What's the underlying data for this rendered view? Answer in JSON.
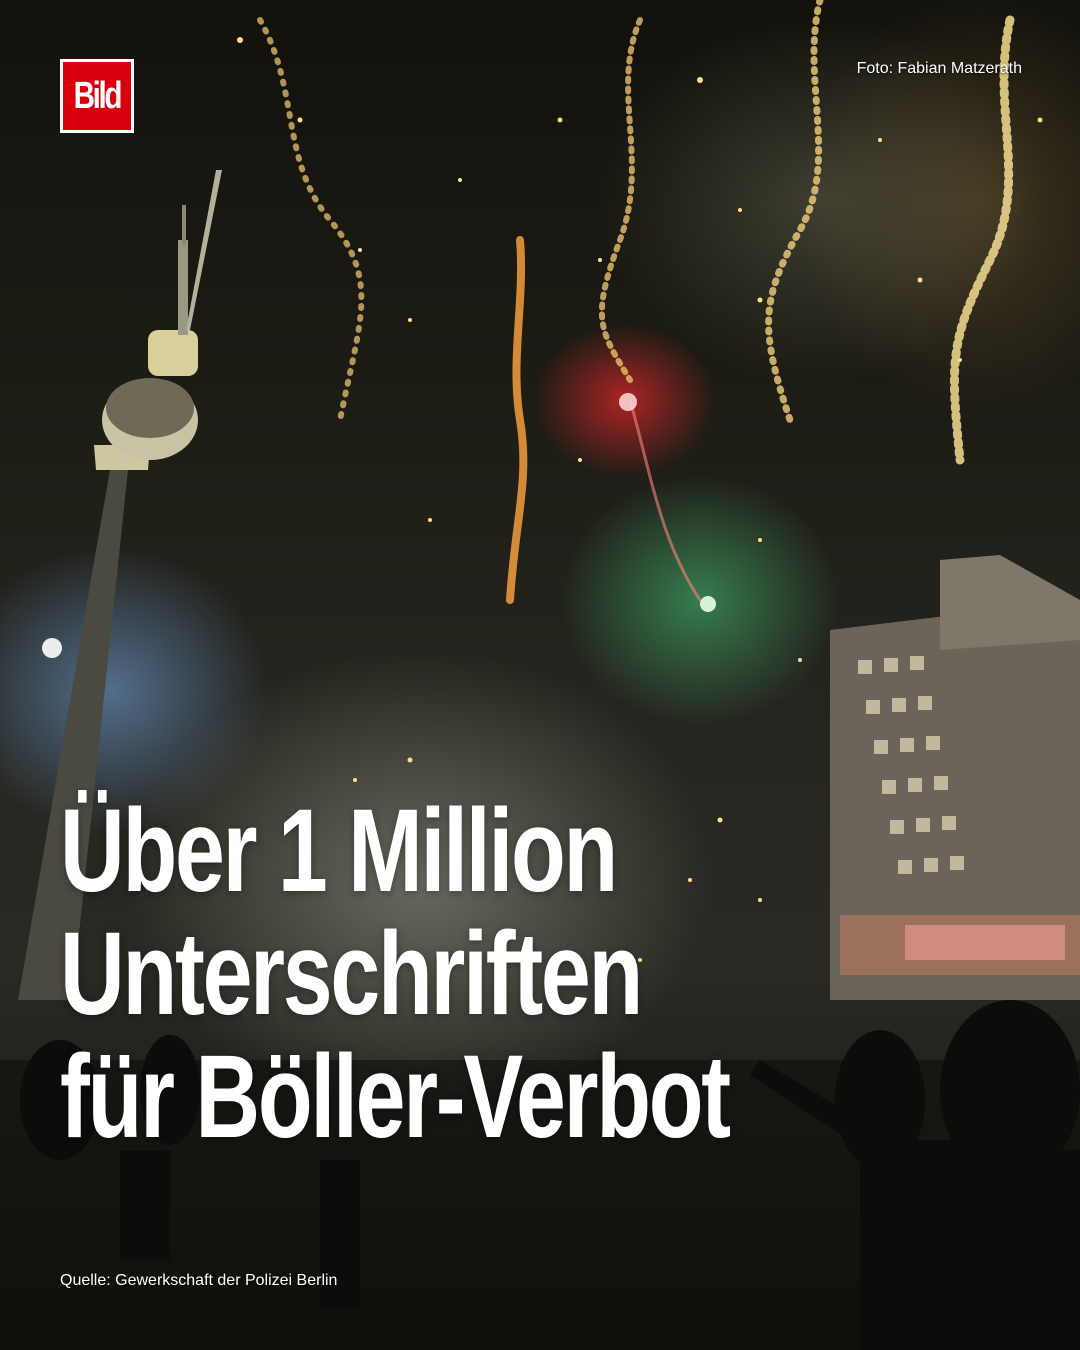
{
  "brand": {
    "logo_text": "Bild",
    "logo_color": "#d8000c"
  },
  "photo_credit": "Foto: Fabian Matzerath",
  "headline": {
    "lines": [
      "Über 1 Million",
      "Unterschriften",
      "für Böller-Verbot"
    ]
  },
  "source": "Quelle: Gewerkschaft der Polizei Berlin"
}
